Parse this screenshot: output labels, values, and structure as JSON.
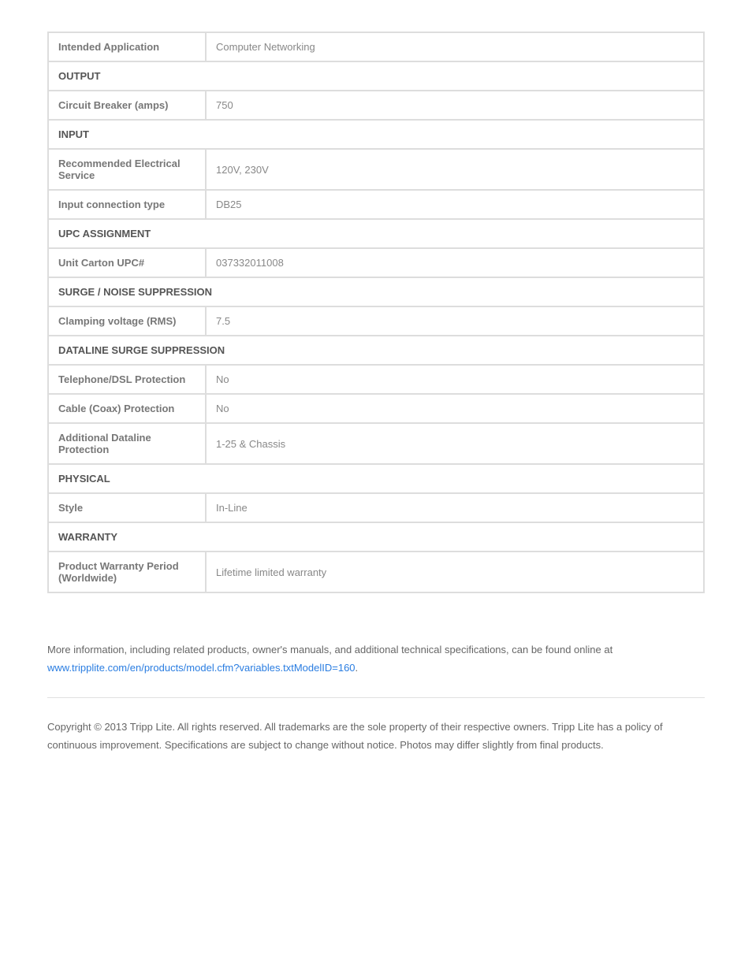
{
  "spec_sections": [
    {
      "rows": [
        {
          "label": "Intended Application",
          "value": "Computer Networking"
        }
      ]
    },
    {
      "header": "OUTPUT",
      "rows": [
        {
          "label": "Circuit Breaker (amps)",
          "value": "750"
        }
      ]
    },
    {
      "header": "INPUT",
      "rows": [
        {
          "label": "Recommended Electrical Service",
          "value": "120V, 230V"
        },
        {
          "label": "Input connection type",
          "value": "DB25"
        }
      ]
    },
    {
      "header": "UPC ASSIGNMENT",
      "rows": [
        {
          "label": "Unit Carton UPC#",
          "value": "037332011008"
        }
      ]
    },
    {
      "header": "SURGE / NOISE SUPPRESSION",
      "rows": [
        {
          "label": "Clamping voltage (RMS)",
          "value": "7.5"
        }
      ]
    },
    {
      "header": "DATALINE SURGE SUPPRESSION",
      "rows": [
        {
          "label": "Telephone/DSL Protection",
          "value": "No"
        },
        {
          "label": "Cable (Coax) Protection",
          "value": "No"
        },
        {
          "label": "Additional Dataline Protection",
          "value": "1-25 & Chassis"
        }
      ]
    },
    {
      "header": "PHYSICAL",
      "rows": [
        {
          "label": "Style",
          "value": "In-Line"
        }
      ]
    },
    {
      "header": "WARRANTY",
      "rows": [
        {
          "label": "Product Warranty Period (Worldwide)",
          "value": "Lifetime limited warranty"
        }
      ]
    }
  ],
  "footer": {
    "more_info_prefix": "More information, including related products, owner's manuals, and additional technical specifications, can be found online at ",
    "link_text": "www.tripplite.com/en/products/model.cfm?variables.txtModelID=160",
    "more_info_suffix": ".",
    "copyright": "Copyright © 2013 Tripp Lite. All rights reserved. All trademarks are the sole property of their respective owners. Tripp Lite has a policy of continuous improvement. Specifications are subject to change without notice. Photos may differ slightly from final products."
  }
}
